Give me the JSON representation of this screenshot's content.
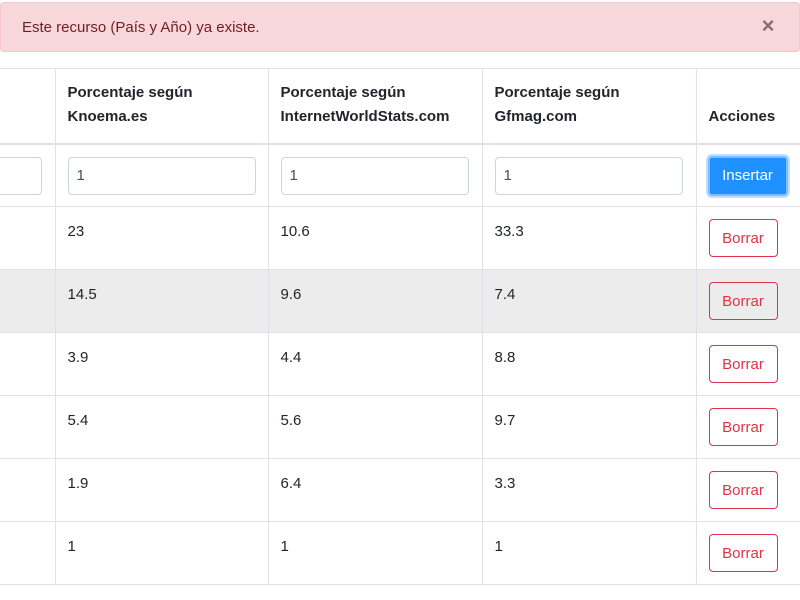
{
  "alert": {
    "message": "Este recurso (País y Año) ya existe.",
    "close_glyph": "×"
  },
  "table": {
    "headers": [
      "Porcentaje según Knoema.es",
      "Porcentaje según InternetWorldStats.com",
      "Porcentaje según Gfmag.com",
      "Acciones"
    ],
    "inputs": {
      "knoema": "1",
      "iws": "1",
      "gfmag": "1"
    },
    "insert_label": "Insertar",
    "delete_label": "Borrar",
    "rows": [
      [
        "23",
        "10.6",
        "33.3"
      ],
      [
        "14.5",
        "9.6",
        "7.4"
      ],
      [
        "3.9",
        "4.4",
        "8.8"
      ],
      [
        "5.4",
        "5.6",
        "9.7"
      ],
      [
        "1.9",
        "6.4",
        "3.3"
      ],
      [
        "1",
        "1",
        "1"
      ]
    ]
  },
  "colors": {
    "primary": "#1e90ff",
    "danger": "#dc3545",
    "alert_bg": "#f8d7da"
  }
}
